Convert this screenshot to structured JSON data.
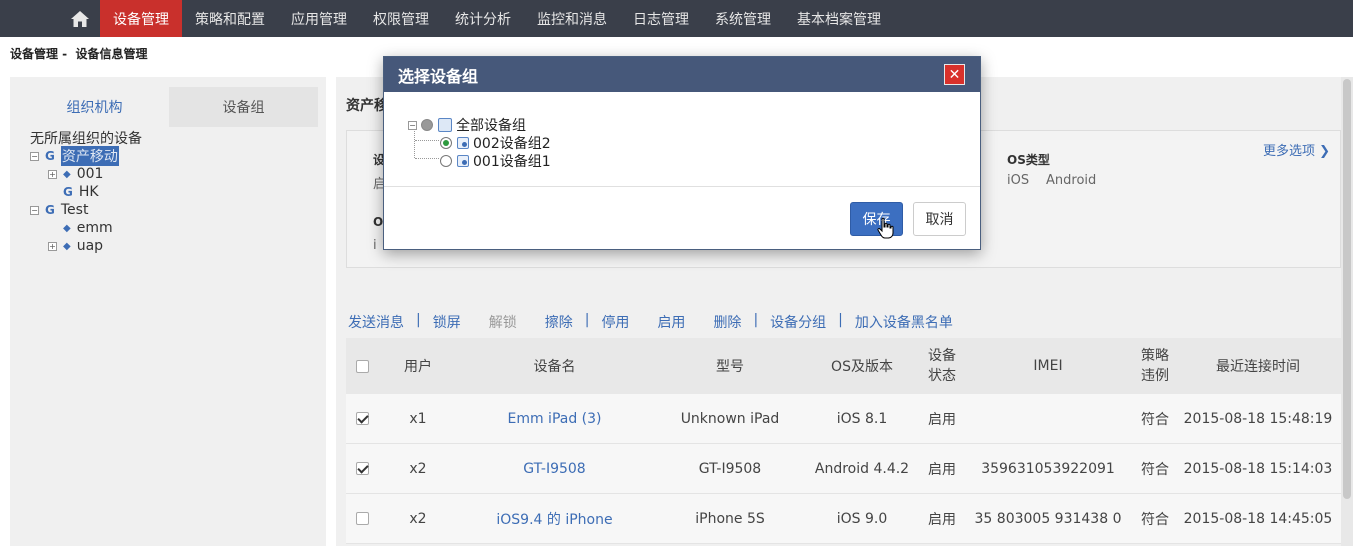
{
  "nav": {
    "items": [
      "设备管理",
      "策略和配置",
      "应用管理",
      "权限管理",
      "统计分析",
      "监控和消息",
      "日志管理",
      "系统管理",
      "基本档案管理"
    ],
    "active_index": 0
  },
  "breadcrumb": {
    "parent": "设备管理 -",
    "current": "设备信息管理"
  },
  "left": {
    "tabs": [
      "组织机构",
      "设备组"
    ],
    "tree": {
      "unassigned": "无所属组织的设备",
      "root1": "资产移动",
      "root1_children": [
        "001",
        "HK"
      ],
      "root2": "Test",
      "root2_children": [
        "emm",
        "uap"
      ]
    }
  },
  "main": {
    "section_title": "资产移",
    "filter": {
      "label_dev": "设",
      "val_dev": "启",
      "label_os": "OS类型",
      "os_options": [
        "iOS",
        "Android"
      ],
      "more": "更多选项",
      "label_o": "O",
      "val_i": "i"
    },
    "actions": [
      "发送消息",
      "锁屏",
      "解锁",
      "擦除",
      "停用",
      "启用",
      "删除",
      "设备分组",
      "加入设备黑名单"
    ],
    "table": {
      "headers": [
        "用户",
        "设备名",
        "型号",
        "OS及版本",
        "设备\n状态",
        "IMEI",
        "策略\n违例",
        "最近连接时间"
      ],
      "header_status_1": "设备",
      "header_status_2": "状态",
      "header_policy_1": "策略",
      "header_policy_2": "违例",
      "rows": [
        {
          "checked": true,
          "user": "x1",
          "name": "Emm iPad (3)",
          "model": "Unknown iPad",
          "os": "iOS 8.1",
          "status": "启用",
          "imei": "",
          "policy": "符合",
          "time": "2015-08-18 15:48:19"
        },
        {
          "checked": true,
          "user": "x2",
          "name": "GT-I9508",
          "model": "GT-I9508",
          "os": "Android 4.4.2",
          "status": "启用",
          "imei": "359631053922091",
          "policy": "符合",
          "time": "2015-08-18 15:14:03"
        },
        {
          "checked": false,
          "user": "x2",
          "name": "iOS9.4 的 iPhone",
          "model": "iPhone 5S",
          "os": "iOS 9.0",
          "status": "启用",
          "imei": "35 803005 931438 0",
          "policy": "符合",
          "time": "2015-08-18 14:45:05"
        }
      ]
    }
  },
  "modal": {
    "title": "选择设备组",
    "close": "✕",
    "root": "全部设备组",
    "groups": [
      {
        "label": "002设备组2",
        "selected": true
      },
      {
        "label": "001设备组1",
        "selected": false
      }
    ],
    "save": "保存",
    "cancel": "取消"
  },
  "colors": {
    "nav_bg": "#3a3f4a",
    "nav_active": "#c9302c",
    "accent": "#3d6db5",
    "modal_head": "#46587a",
    "close": "#d9312b"
  }
}
